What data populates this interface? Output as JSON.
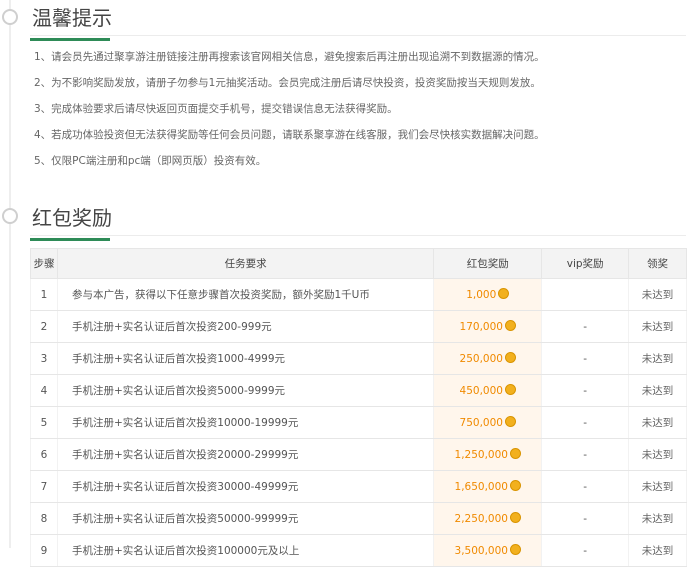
{
  "sections": {
    "tips_title": "温馨提示",
    "rewards_title": "红包奖励"
  },
  "tips": [
    "1、请会员先通过聚享游注册链接注册再搜索该官网相关信息，避免搜索后再注册出现追溯不到数据源的情况。",
    "2、为不影响奖励发放，请册子勿参与1元抽奖活动。会员完成注册后请尽快投资，投资奖励按当天规则发放。",
    "3、完成体验要求后请尽快返回页面提交手机号，提交错误信息无法获得奖励。",
    "4、若成功体验投资但无法获得奖励等任何会员问题，请联系聚享游在线客服，我们会尽快核实数据解决问题。",
    "5、仅限PC端注册和pc端（即网页版）投资有效。"
  ],
  "table": {
    "headers": [
      "步骤",
      "任务要求",
      "红包奖励",
      "vip奖励",
      "领奖"
    ],
    "rows": [
      {
        "step": "1",
        "task": "参与本广告，获得以下任意步骤首次投资奖励，额外奖励1千U币",
        "reward": "1,000",
        "vip": "",
        "status": "未达到"
      },
      {
        "step": "2",
        "task": "手机注册+实名认证后首次投资200-999元",
        "reward": "170,000",
        "vip": "-",
        "status": "未达到"
      },
      {
        "step": "3",
        "task": "手机注册+实名认证后首次投资1000-4999元",
        "reward": "250,000",
        "vip": "-",
        "status": "未达到"
      },
      {
        "step": "4",
        "task": "手机注册+实名认证后首次投资5000-9999元",
        "reward": "450,000",
        "vip": "-",
        "status": "未达到"
      },
      {
        "step": "5",
        "task": "手机注册+实名认证后首次投资10000-19999元",
        "reward": "750,000",
        "vip": "-",
        "status": "未达到"
      },
      {
        "step": "6",
        "task": "手机注册+实名认证后首次投资20000-29999元",
        "reward": "1,250,000",
        "vip": "-",
        "status": "未达到"
      },
      {
        "step": "7",
        "task": "手机注册+实名认证后首次投资30000-49999元",
        "reward": "1,650,000",
        "vip": "-",
        "status": "未达到"
      },
      {
        "step": "8",
        "task": "手机注册+实名认证后首次投资50000-99999元",
        "reward": "2,250,000",
        "vip": "-",
        "status": "未达到"
      },
      {
        "step": "9",
        "task": "手机注册+实名认证后首次投资100000元及以上",
        "reward": "3,500,000",
        "vip": "-",
        "status": "未达到"
      }
    ]
  },
  "colors": {
    "accent": "#2e8b57",
    "reward_text": "#f08a00",
    "reward_bg": "#fff6ec",
    "coin": "#f2b01e"
  },
  "icons": {
    "coin": "gold-coin-icon",
    "section_marker": "circle-marker-icon"
  }
}
